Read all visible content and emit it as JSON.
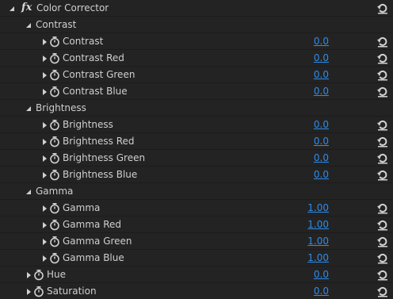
{
  "effect": {
    "fx_label": "fx",
    "name": "Color Corrector",
    "reset_icon": "reset-icon"
  },
  "groups": [
    {
      "name": "Contrast",
      "params": [
        {
          "name": "Contrast",
          "value": "0.0"
        },
        {
          "name": "Contrast Red",
          "value": "0.0"
        },
        {
          "name": "Contrast Green",
          "value": "0.0"
        },
        {
          "name": "Contrast Blue",
          "value": "0.0"
        }
      ]
    },
    {
      "name": "Brightness",
      "params": [
        {
          "name": "Brightness",
          "value": "0.0"
        },
        {
          "name": "Brightness Red",
          "value": "0.0"
        },
        {
          "name": "Brightness Green",
          "value": "0.0"
        },
        {
          "name": "Brightness Blue",
          "value": "0.0"
        }
      ]
    },
    {
      "name": "Gamma",
      "params": [
        {
          "name": "Gamma",
          "value": "1.00"
        },
        {
          "name": "Gamma Red",
          "value": "1.00"
        },
        {
          "name": "Gamma Green",
          "value": "1.00"
        },
        {
          "name": "Gamma Blue",
          "value": "1.00"
        }
      ]
    }
  ],
  "top_params": [
    {
      "name": "Hue",
      "value": "0.0"
    },
    {
      "name": "Saturation",
      "value": "0.0"
    }
  ],
  "colors": {
    "background": "#232323",
    "text": "#cfcfcf",
    "value_link": "#2d8ceb",
    "icon": "#d0d0d0"
  }
}
